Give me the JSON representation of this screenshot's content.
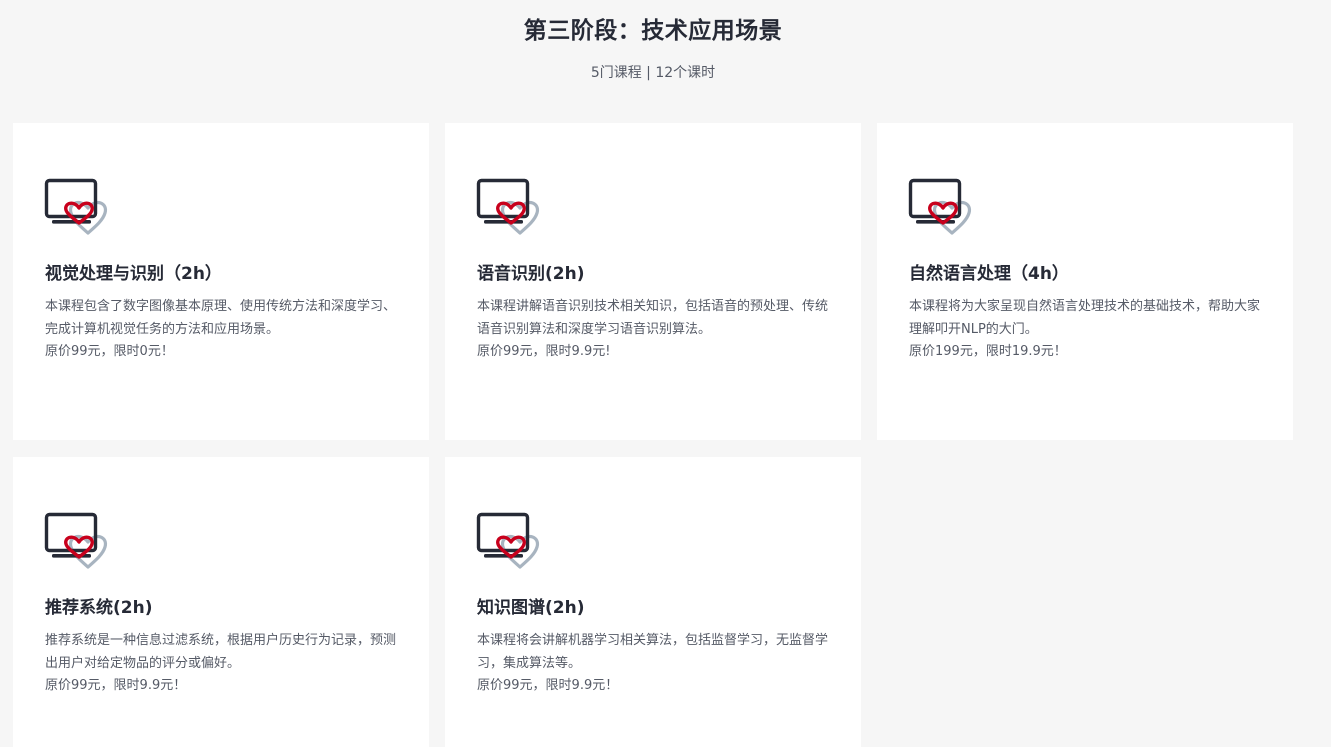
{
  "header": {
    "title": "第三阶段：技术应用场景",
    "subtitle": "5门课程 | 12个课时"
  },
  "colors": {
    "page_background": "#f6f6f6",
    "card_background": "#ffffff",
    "title_text": "#262a36",
    "body_text": "#555a66",
    "icon_monitor": "#262a36",
    "icon_heart": "#c8001c",
    "icon_heart_shadow": "#a8b4c0"
  },
  "courses": [
    {
      "icon": "monitor-heart-icon",
      "title": "视觉处理与识别（2h）",
      "description": "本课程包含了数字图像基本原理、使用传统方法和深度学习、完成计算机视觉任务的方法和应用场景。",
      "price": "原价99元，限时0元！"
    },
    {
      "icon": "monitor-heart-icon",
      "title": "语音识别(2h)",
      "description": "本课程讲解语音识别技术相关知识，包括语音的预处理、传统语音识别算法和深度学习语音识别算法。",
      "price": "原价99元，限时9.9元!"
    },
    {
      "icon": "monitor-heart-icon",
      "title": "自然语言处理（4h）",
      "description": "本课程将为大家呈现自然语言处理技术的基础技术，帮助大家理解叩开NLP的大门。",
      "price": "原价199元，限时19.9元！"
    },
    {
      "icon": "monitor-heart-icon",
      "title": "推荐系统(2h)",
      "description": "推荐系统是一种信息过滤系统，根据用户历史行为记录，预测出用户对给定物品的评分或偏好。",
      "price": "原价99元，限时9.9元！"
    },
    {
      "icon": "monitor-heart-icon",
      "title": "知识图谱(2h)",
      "description": "本课程将会讲解机器学习相关算法，包括监督学习，无监督学习，集成算法等。",
      "price": "原价99元，限时9.9元！"
    }
  ]
}
